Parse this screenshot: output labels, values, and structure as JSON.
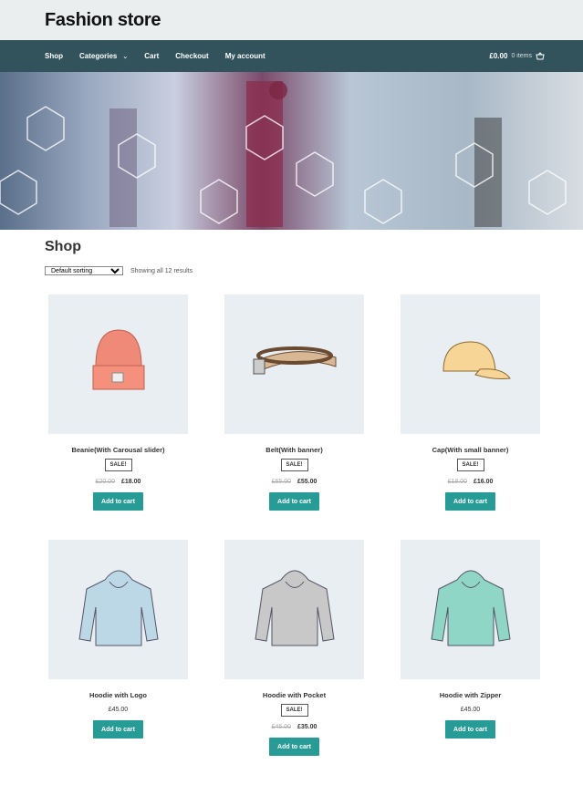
{
  "site": {
    "title": "Fashion store"
  },
  "nav": {
    "items": [
      {
        "label": "Shop"
      },
      {
        "label": "Categories"
      },
      {
        "label": "Cart"
      },
      {
        "label": "Checkout"
      },
      {
        "label": "My account"
      }
    ],
    "cart_total": "£0.00",
    "cart_count": "0 items"
  },
  "shop": {
    "title": "Shop",
    "sorting": "Default sorting",
    "results": "Showing all 12 results"
  },
  "colors": {
    "nav_bg": "#32525c",
    "button": "#279b96",
    "header_bg": "#ebeeef"
  },
  "products": [
    {
      "name": "Beanie(With Carousal slider)",
      "sale": "SALE!",
      "old_price": "£20.00",
      "price": "£18.00",
      "button": "Add to cart",
      "icon": "beanie"
    },
    {
      "name": "Belt(With banner)",
      "sale": "SALE!",
      "old_price": "£65.00",
      "price": "£55.00",
      "button": "Add to cart",
      "icon": "belt"
    },
    {
      "name": "Cap(With small banner)",
      "sale": "SALE!",
      "old_price": "£18.00",
      "price": "£16.00",
      "button": "Add to cart",
      "icon": "cap"
    },
    {
      "name": "Hoodie with Logo",
      "price": "£45.00",
      "button": "Add to cart",
      "icon": "hoodie-logo"
    },
    {
      "name": "Hoodie with Pocket",
      "sale": "SALE!",
      "old_price": "£45.00",
      "price": "£35.00",
      "button": "Add to cart",
      "icon": "hoodie-pocket"
    },
    {
      "name": "Hoodie with Zipper",
      "price": "£45.00",
      "button": "Add to cart",
      "icon": "hoodie-zipper"
    }
  ]
}
